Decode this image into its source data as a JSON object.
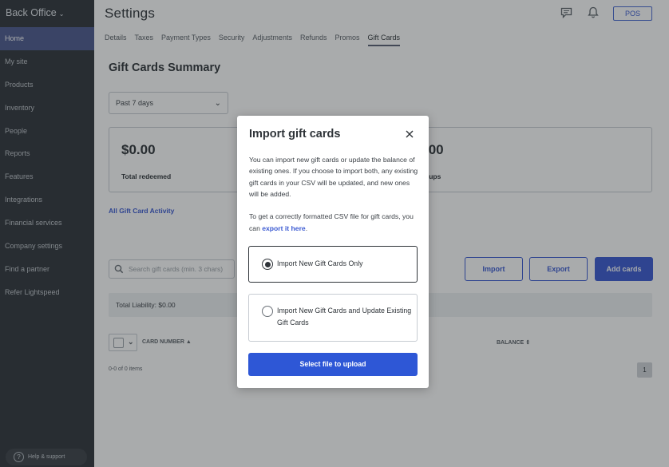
{
  "sidebar": {
    "brand": "Back Office",
    "items": [
      {
        "label": "Home"
      },
      {
        "label": "My site"
      },
      {
        "label": "Products"
      },
      {
        "label": "Inventory"
      },
      {
        "label": "People"
      },
      {
        "label": "Reports"
      },
      {
        "label": "Features"
      },
      {
        "label": "Integrations"
      },
      {
        "label": "Financial services"
      },
      {
        "label": "Company settings"
      },
      {
        "label": "Find a partner"
      },
      {
        "label": "Refer Lightspeed"
      }
    ],
    "active_item": "Home",
    "help_label": "Help & support"
  },
  "header": {
    "title": "Settings",
    "pos_label": "POS",
    "icons": [
      "chat-icon",
      "bell-icon"
    ]
  },
  "tabs": [
    {
      "label": "Details"
    },
    {
      "label": "Taxes"
    },
    {
      "label": "Payment Types"
    },
    {
      "label": "Security"
    },
    {
      "label": "Adjustments"
    },
    {
      "label": "Refunds"
    },
    {
      "label": "Promos"
    },
    {
      "label": "Gift Cards"
    }
  ],
  "active_tab": "Gift Cards",
  "summary": {
    "title": "Gift Cards Summary",
    "range": "Past 7 days",
    "redeemed_amount": "$0.00",
    "redeemed_label": "Total redeemed",
    "topups_amount": ".00",
    "topups_label": "pups",
    "activity_link": "All Gift Card Activity"
  },
  "toolbar": {
    "search_placeholder": "Search gift cards (min. 3 chars)",
    "import_label": "Import",
    "export_label": "Export",
    "add_label": "Add cards"
  },
  "table": {
    "liability": "Total Liability: $0.00",
    "col_card_number": "CARD NUMBER",
    "col_balance": "BALANCE",
    "items_text": "0-0 of 0 items",
    "page": "1"
  },
  "modal": {
    "title": "Import gift cards",
    "paragraph1": "You can import new gift cards or update the balance of existing ones. If you choose to import both, any existing gift cards in your CSV will be updated, and new ones will be added.",
    "paragraph2_prefix": "To get a correctly formatted CSV file for gift cards, you can ",
    "paragraph2_link": "export it here",
    "paragraph2_suffix": ".",
    "option1": "Import New Gift Cards Only",
    "option2": "Import New Gift Cards and Update Existing Gift Cards",
    "selected_option": 1,
    "upload_label": "Select file to upload"
  },
  "colors": {
    "sidebar_bg": "#30353b",
    "accent": "#2e57d6",
    "active_nav": "#4d5a8f"
  }
}
